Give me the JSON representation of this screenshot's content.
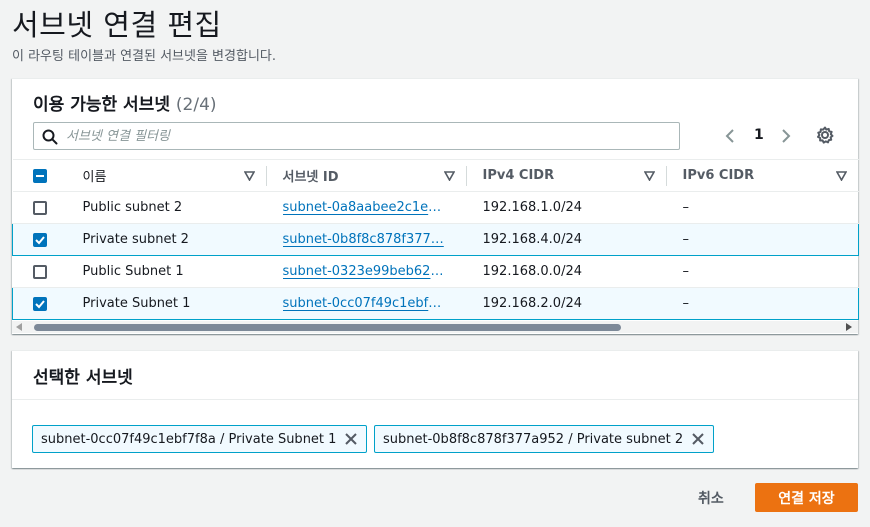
{
  "page": {
    "title": "서브넷 연결 편집",
    "description": "이 라우팅 테이블과 연결된 서브넷을 변경합니다."
  },
  "available": {
    "title": "이용 가능한 서브넷",
    "count": "(2/4)",
    "filter_placeholder": "서브넷 연결 필터링",
    "page": "1",
    "columns": [
      "이름",
      "서브넷 ID",
      "IPv4 CIDR",
      "IPv6 CIDR"
    ],
    "rows": [
      {
        "name": "Public subnet 2",
        "id": "subnet-0a8aabee2c1eb…",
        "ipv4": "192.168.1.0/24",
        "ipv6": "–",
        "selected": false
      },
      {
        "name": "Private subnet 2",
        "id": "subnet-0b8f8c878f377…",
        "ipv4": "192.168.4.0/24",
        "ipv6": "–",
        "selected": true
      },
      {
        "name": "Public Subnet 1",
        "id": "subnet-0323e99beb62f…",
        "ipv4": "192.168.0.0/24",
        "ipv6": "–",
        "selected": false
      },
      {
        "name": "Private Subnet 1",
        "id": "subnet-0cc07f49c1ebf7…",
        "ipv4": "192.168.2.0/24",
        "ipv6": "–",
        "selected": true
      }
    ]
  },
  "selected": {
    "title": "선택한 서브넷",
    "tokens": [
      "subnet-0cc07f49c1ebf7f8a / Private Subnet 1",
      "subnet-0b8f8c878f377a952 / Private subnet 2"
    ]
  },
  "actions": {
    "cancel": "취소",
    "save": "연결 저장"
  },
  "colors": {
    "primary_button": "#ec7211",
    "link": "#0073bb",
    "selection_border": "#00a1c9",
    "selection_bg": "#f1faff"
  }
}
